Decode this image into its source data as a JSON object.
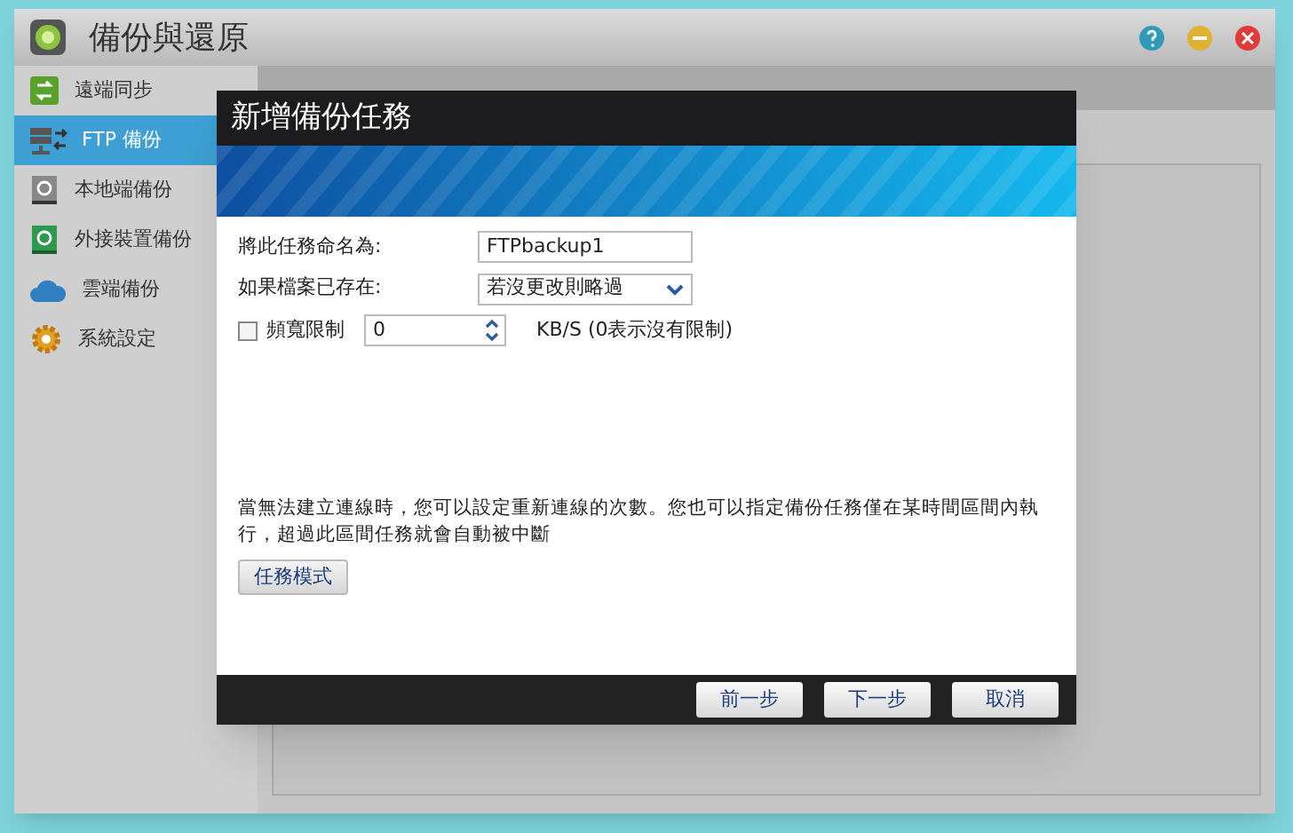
{
  "window": {
    "title": "備份與還原"
  },
  "sidebar": {
    "items": [
      {
        "label": "遠端同步",
        "selected": false,
        "kind": "sync"
      },
      {
        "label": "FTP 備份",
        "selected": true,
        "kind": "ftp"
      },
      {
        "label": "本地端備份",
        "selected": false,
        "kind": "local"
      },
      {
        "label": "外接裝置備份",
        "selected": false,
        "kind": "external"
      },
      {
        "label": "雲端備份",
        "selected": false,
        "kind": "cloud"
      },
      {
        "label": "系統設定",
        "selected": false,
        "kind": "settings"
      }
    ]
  },
  "dialog": {
    "title": "新增備份任務",
    "name_field": {
      "label": "將此任務命名為:",
      "value": "FTPbackup1"
    },
    "exists_field": {
      "label": "如果檔案已存在:",
      "value": "若沒更改則略過"
    },
    "bandwidth": {
      "label": "頻寬限制",
      "checked": false,
      "value": "0",
      "unit": "KB/S (0表示沒有限制)"
    },
    "note": "當無法建立連線時，您可以設定重新連線的次數。您也可以指定備份任務僅在某時間區間內執行，超過此區間任務就會自動被中斷",
    "mode_button": "任務模式",
    "buttons": [
      "前一步",
      "下一步",
      "取消"
    ]
  }
}
